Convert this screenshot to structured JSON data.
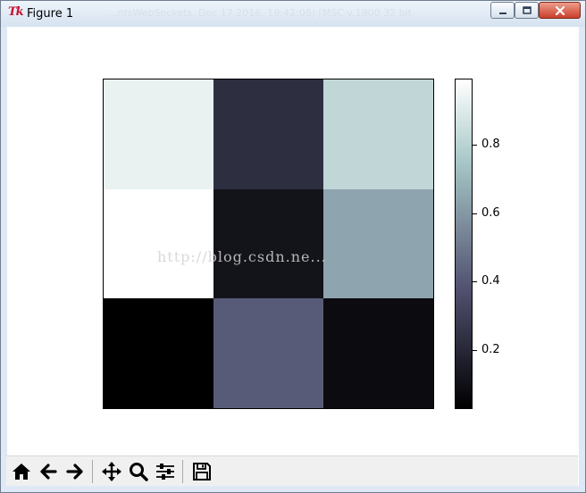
{
  "window": {
    "title": "Figure 1",
    "logo_text": "Tk",
    "background_title": "...ntsWebSockets, Dec 17 2016, 19:42:08) [MSC v.1900 32 bit"
  },
  "toolbar": {
    "buttons": [
      {
        "name": "home",
        "icon": "home-icon"
      },
      {
        "name": "back",
        "icon": "arrow-left-icon"
      },
      {
        "name": "forward",
        "icon": "arrow-right-icon"
      },
      {
        "name": "pan",
        "icon": "move-icon"
      },
      {
        "name": "zoom",
        "icon": "magnifier-icon"
      },
      {
        "name": "configure-subplots",
        "icon": "sliders-icon"
      },
      {
        "name": "save",
        "icon": "floppy-disk-icon"
      }
    ]
  },
  "watermark": "http://blog.csdn.ne...",
  "chart_data": {
    "type": "heatmap",
    "colormap": "bone",
    "rows": 3,
    "cols": 3,
    "values": [
      [
        0.93,
        0.23,
        0.82
      ],
      [
        0.99,
        0.11,
        0.64
      ],
      [
        0.03,
        0.41,
        0.08
      ]
    ],
    "vmin": 0.03,
    "vmax": 0.99,
    "colorbar_ticks": [
      0.2,
      0.4,
      0.6,
      0.8
    ],
    "colorbar_tick_labels": [
      "0.2",
      "0.4",
      "0.6",
      "0.8"
    ],
    "title": "",
    "xlabel": "",
    "ylabel": "",
    "grid": false,
    "axes_ticks": false
  }
}
